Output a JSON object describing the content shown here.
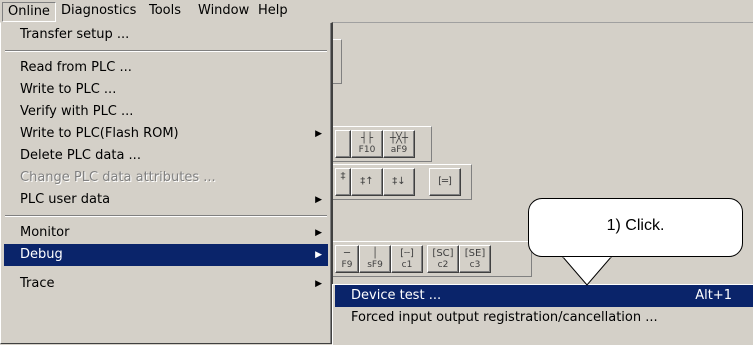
{
  "menubar": {
    "items": [
      {
        "label": "Online"
      },
      {
        "label": "Diagnostics"
      },
      {
        "label": "Tools"
      },
      {
        "label": "Window"
      },
      {
        "label": "Help"
      }
    ]
  },
  "online_menu": {
    "items": [
      {
        "label": "Transfer setup ..."
      },
      {
        "label": "Read from PLC ..."
      },
      {
        "label": "Write to PLC ..."
      },
      {
        "label": "Verify with PLC ..."
      },
      {
        "label": "Write to PLC(Flash ROM)"
      },
      {
        "label": "Delete PLC data ..."
      },
      {
        "label": "Change PLC data attributes ..."
      },
      {
        "label": "PLC user data"
      },
      {
        "label": "Monitor"
      },
      {
        "label": "Debug"
      },
      {
        "label": "Trace"
      }
    ]
  },
  "debug_submenu": {
    "items": [
      {
        "label": "Device test ...",
        "shortcut": "Alt+1"
      },
      {
        "label": "Forced input output registration/cancellation ..."
      }
    ]
  },
  "toolbar": {
    "row1": [
      {
        "key": "F10"
      },
      {
        "key": "aF9"
      }
    ],
    "row3": [
      {
        "key": "sF9"
      },
      {
        "key": "c1"
      },
      {
        "key": "c2"
      },
      {
        "key": "c3"
      }
    ],
    "row3_first_partial_key": "F9"
  },
  "callout": {
    "text": "1) Click."
  },
  "colors": {
    "highlight": "#0a246a",
    "face": "#d4d0c8"
  }
}
